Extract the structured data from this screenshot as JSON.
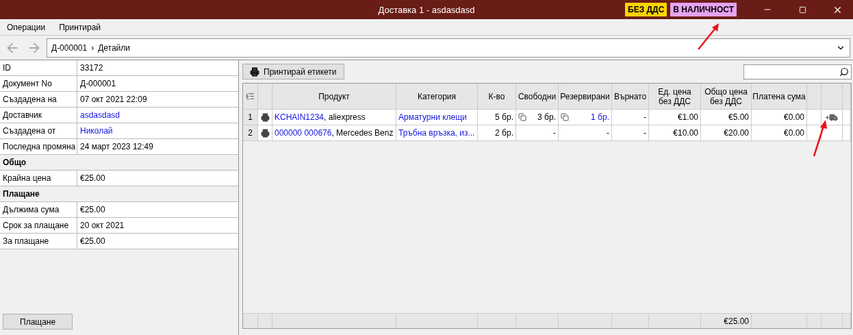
{
  "window": {
    "title": "Доставка 1 - asdasdasd",
    "badges": [
      {
        "label": "БЕЗ ДДС",
        "color": "#ffd400"
      },
      {
        "label": "В НАЛИЧНОСТ",
        "color": "#e6a3f0"
      }
    ]
  },
  "menu": [
    "Операции",
    "Принтирай"
  ],
  "breadcrumb": {
    "document": "Д-000001",
    "separator": "›",
    "page": "Детайли"
  },
  "details": [
    {
      "kind": "field",
      "label": "ID",
      "value": "33172",
      "link": false
    },
    {
      "kind": "field",
      "label": "Документ No",
      "value": "Д-000001",
      "link": false
    },
    {
      "kind": "field",
      "label": "Създадена на",
      "value": "07 окт 2021 22:09",
      "link": false
    },
    {
      "kind": "field",
      "label": "Доставчик",
      "value": "asdasdasd",
      "link": true
    },
    {
      "kind": "field",
      "label": "Създадена от",
      "value": "Николай",
      "link": true
    },
    {
      "kind": "field",
      "label": "Последна промяна",
      "value": "24 март 2023 12:49",
      "link": false
    },
    {
      "kind": "section",
      "label": "Общо"
    },
    {
      "kind": "field",
      "label": "Крайна цена",
      "value": "€25.00",
      "link": false
    },
    {
      "kind": "section",
      "label": "Плащане"
    },
    {
      "kind": "field",
      "label": "Дължима сума",
      "value": "€25.00",
      "link": false
    },
    {
      "kind": "field",
      "label": "Срок за плащане",
      "value": "20 окт 2021",
      "link": false
    },
    {
      "kind": "field",
      "label": "За плащане",
      "value": "€25.00",
      "link": false
    }
  ],
  "pay_button": "Плащане",
  "print_labels_button": "Принтирай етикети",
  "table": {
    "columns": [
      "Продукт",
      "Категория",
      "К-во",
      "Свободни",
      "Резервирани",
      "Върнато",
      "Ед. цена без ДДС",
      "Общо цена без ДДС",
      "Платена сума"
    ],
    "rows": [
      {
        "number": "1",
        "product_code": "KCHAIN1234",
        "product_rest": ", aliexpress",
        "category": "Арматурни клещи",
        "qty": "5 бр.",
        "free": {
          "kind": "stock",
          "text": "3 бр."
        },
        "reserved": {
          "kind": "stock-link",
          "text": "1 бр."
        },
        "returned": "-",
        "unit_price": "€1.00",
        "total_price": "€5.00",
        "paid": "€0.00",
        "delivery_action": true
      },
      {
        "number": "2",
        "product_code": "000000 000676",
        "product_rest": ", Mercedes Benz",
        "category": "Тръбна връзка, из...",
        "qty": "2 бр.",
        "free": {
          "kind": "plain",
          "text": "-"
        },
        "reserved": {
          "kind": "plain",
          "text": "-"
        },
        "returned": "-",
        "unit_price": "€10.00",
        "total_price": "€20.00",
        "paid": "€0.00",
        "delivery_action": false
      }
    ],
    "footer_total": "€25.00"
  }
}
